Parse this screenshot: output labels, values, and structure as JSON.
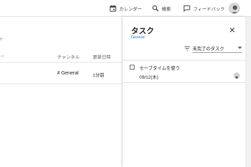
{
  "topbar": {
    "calendar_label": "カレンダー",
    "search_label": "検索",
    "feedback_label": "フィードバック"
  },
  "list": {
    "marks": [
      "e",
      "ー"
    ],
    "columns": {
      "channel": "チャンネル",
      "updated": "更新日時"
    },
    "rows": [
      {
        "channel": "# General",
        "updated": "1分前"
      }
    ]
  },
  "task_panel": {
    "title": "タスク",
    "subtitle": "General",
    "filter": {
      "selected": "未完了のタスク"
    },
    "tasks": [
      {
        "title": "セーブタイムを使う",
        "date": "09/12(木)",
        "checked": false
      }
    ]
  },
  "colors": {
    "accent": "#1a73e8",
    "text": "#202124",
    "secondary_text": "#5f6368",
    "background": "#f3f3f3"
  },
  "icons": {
    "calendar": "calendar-icon",
    "search": "search-icon",
    "feedback": "feedback-icon",
    "filter": "filter-icon",
    "close": "close-icon",
    "dropdown": "chevron-down-icon"
  }
}
